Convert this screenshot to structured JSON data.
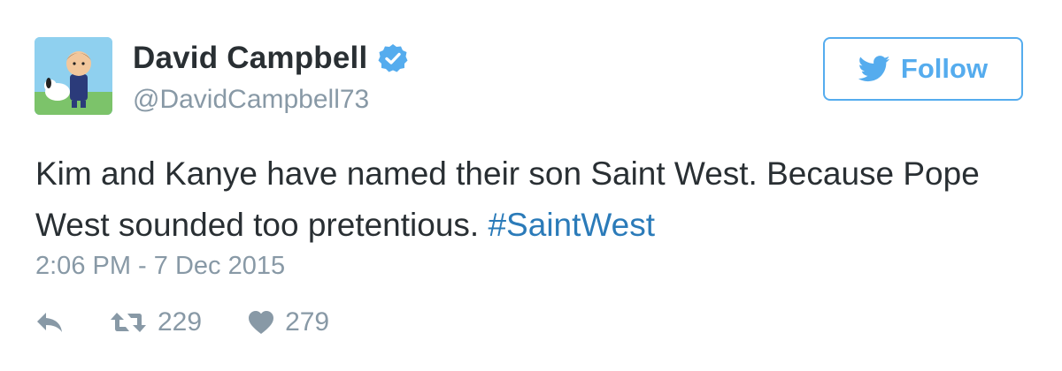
{
  "tweet": {
    "display_name": "David Campbell",
    "handle": "@DavidCampbell73",
    "text_main": "Kim and Kanye have named their son Saint West. Because Pope West sounded too pretentious. ",
    "hashtag": "#SaintWest",
    "timestamp": "2:06 PM - 7 Dec 2015",
    "retweet_count": "229",
    "like_count": "279"
  },
  "follow": {
    "label": "Follow"
  },
  "icons": {
    "avatar": "avatar-cartoon",
    "verified": "verified-badge-icon",
    "follow_bird": "twitter-bird-icon",
    "reply": "reply-icon",
    "retweet": "retweet-icon",
    "like": "heart-icon"
  },
  "colors": {
    "accent": "#55acee",
    "hashtag": "#2b7bb9",
    "muted": "#8899a6",
    "text": "#292f33"
  }
}
